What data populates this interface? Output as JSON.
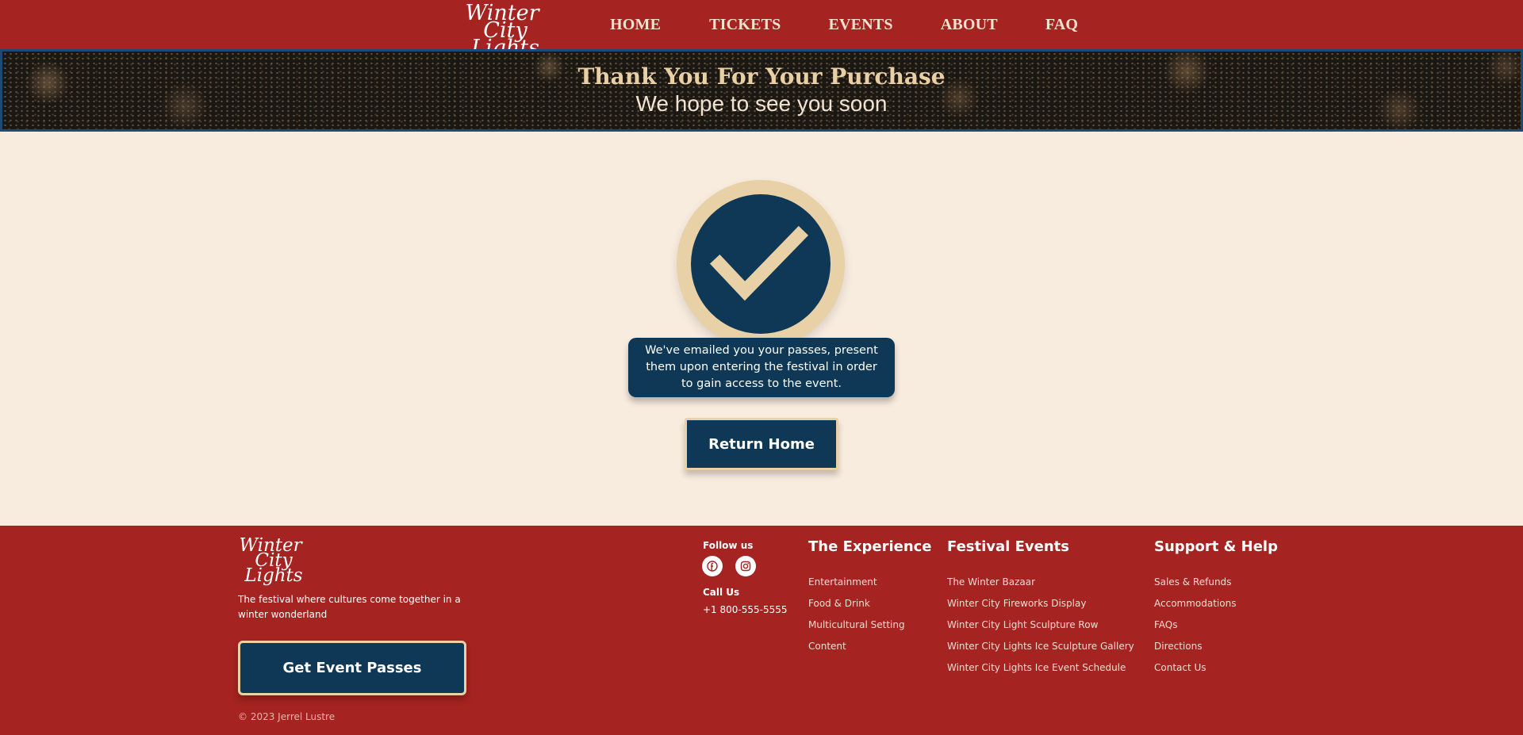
{
  "brand": {
    "line1": "Winter",
    "line2": "City Lights"
  },
  "nav": {
    "items": [
      "HOME",
      "TICKETS",
      "EVENTS",
      "ABOUT",
      "FAQ"
    ]
  },
  "hero": {
    "title": "Thank You For Your Purchase",
    "subtitle": "We hope to see you soon"
  },
  "confirmation": {
    "icon": "checkmark-icon",
    "message": "We've emailed you your passes, present them upon entering the festival in order to gain access to the event.",
    "button": "Return Home"
  },
  "footer": {
    "tagline": "The festival where cultures come together in a winter wonderland",
    "cta": "Get Event Passes",
    "copyright": "© 2023 Jerrel Lustre",
    "follow_heading": "Follow us",
    "social": [
      "facebook-icon",
      "instagram-icon"
    ],
    "call_heading": "Call Us",
    "phone": "+1 800-555-5555",
    "columns": [
      {
        "heading": "The Experience",
        "links": [
          "Entertainment",
          "Food & Drink",
          "Multicultural Setting",
          "Content"
        ]
      },
      {
        "heading": "Festival Events",
        "links": [
          "The Winter Bazaar",
          "Winter City Fireworks Display",
          "Winter City Light Sculpture Row",
          "Winter City Lights Ice Sculpture Gallery",
          "Winter City Lights Ice Event Schedule"
        ]
      },
      {
        "heading": "Support & Help",
        "links": [
          "Sales & Refunds",
          "Accommodations",
          "FAQs",
          "Directions",
          "Contact Us"
        ]
      }
    ]
  },
  "colors": {
    "brand_red": "#a52320",
    "navy": "#0e3856",
    "gold": "#e8d1a6",
    "cream": "#f8ecdf"
  }
}
